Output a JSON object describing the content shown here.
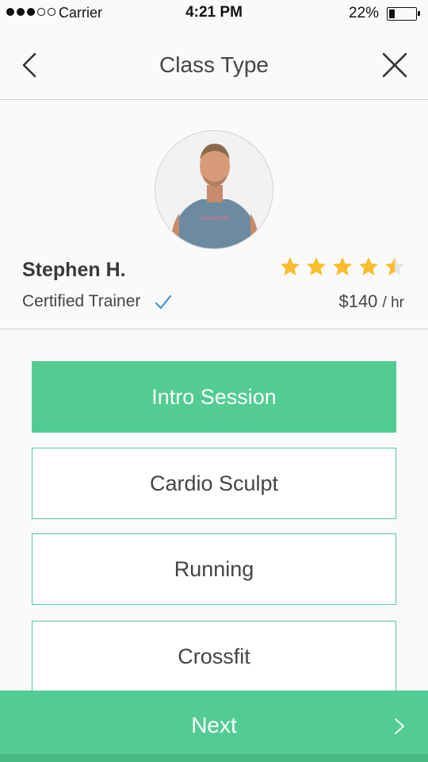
{
  "status_bar": {
    "carrier": "Carrier",
    "time": "4:21 PM",
    "battery_percent": "22%",
    "battery_level": 0.22,
    "signal_bars": 3,
    "signal_total": 5
  },
  "nav": {
    "title": "Class Type",
    "back_icon": "chevron-left-icon",
    "close_icon": "close-icon"
  },
  "trainer": {
    "name": "Stephen H.",
    "role": "Certified Trainer",
    "verified_icon": "checkmark-icon",
    "rating": 4.5,
    "rating_max": 5,
    "price": "$140",
    "price_unit": "/ hr"
  },
  "class_options": [
    {
      "label": "Intro Session",
      "selected": true
    },
    {
      "label": "Cardio Sculpt",
      "selected": false
    },
    {
      "label": "Running",
      "selected": false
    },
    {
      "label": "Crossfit",
      "selected": false
    }
  ],
  "footer": {
    "next_label": "Next",
    "next_icon": "chevron-right-icon"
  },
  "colors": {
    "accent": "#52cc93",
    "star": "#fbbd2b",
    "check": "#4a90d9"
  }
}
